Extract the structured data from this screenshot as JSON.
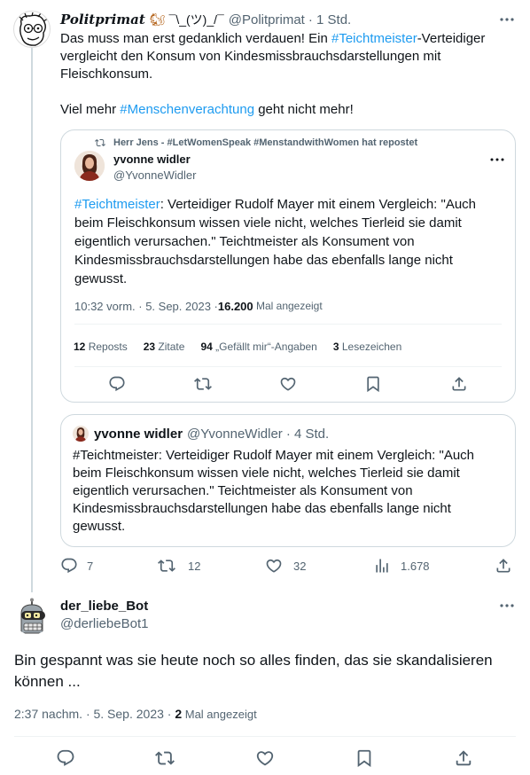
{
  "main_post": {
    "name": "Politprimat",
    "emoji_shrug": "¯\\_(ツ)_/¯",
    "handle": "@Politprimat",
    "time": "· 1 Std.",
    "text_1": "Das muss man erst gedanklich verdauen! Ein ",
    "hashtag_1": "#Teichtmeister",
    "text_2": "-Verteidiger vergleicht den Konsum von Kindesmissbrauchsdarstellungen mit Fleischkonsum.",
    "text_3": "Viel mehr ",
    "hashtag_2": "#Menschenverachtung",
    "text_4": " geht nicht mehr!",
    "actions": {
      "replies": "7",
      "reposts": "12",
      "likes": "32",
      "views": "1.678"
    }
  },
  "embedded_post": {
    "repost_note": "Herr Jens - #LetWomenSpeak #MenstandwithWomen hat repostet",
    "name": "yvonne widler",
    "handle": "@YvonneWidler",
    "hashtag": "#Teichtmeister",
    "text": ": Verteidiger Rudolf Mayer mit einem Vergleich: \"Auch beim Fleischkonsum wissen viele nicht, welches Tierleid sie damit eigentlich verursachen.\" Teichtmeister als Konsument von Kindesmissbrauchsdarstellungen habe das ebenfalls lange nicht gewusst.",
    "meta_time": "10:32 vorm. · 5. Sep. 2023 · ",
    "meta_views": "16.200",
    "meta_views_label": " Mal angezeigt",
    "stats": {
      "reposts_num": "12",
      "reposts_label": " Reposts",
      "quotes_num": "23",
      "quotes_label": " Zitate",
      "likes_num": "94",
      "likes_label": " „Gefällt mir“-Angaben",
      "bookmarks_num": "3",
      "bookmarks_label": " Lesezeichen"
    }
  },
  "quoted_post": {
    "name": "yvonne widler",
    "handle": "@YvonneWidler",
    "time": "· 4 Std.",
    "text": "#Teichtmeister: Verteidiger Rudolf Mayer mit einem Vergleich: \"Auch beim Fleischkonsum wissen viele nicht, welches Tierleid sie damit eigentlich verursachen.\" Teichtmeister als Konsument von Kindesmissbrauchsdarstellungen habe das ebenfalls lange nicht gewusst."
  },
  "reply_post": {
    "name": "der_liebe_Bot",
    "handle": "@derliebeBot1",
    "text": "Bin gespannt was sie heute noch so alles finden, das sie skandalisieren können ...",
    "meta_time": "2:37 nachm. · 5. Sep. 2023 · ",
    "meta_views": "2",
    "meta_views_label": " Mal angezeigt"
  },
  "colors": {
    "accent": "#1d9bf0",
    "text": "#0f1419",
    "muted": "#536471",
    "border": "#cfd9de"
  }
}
